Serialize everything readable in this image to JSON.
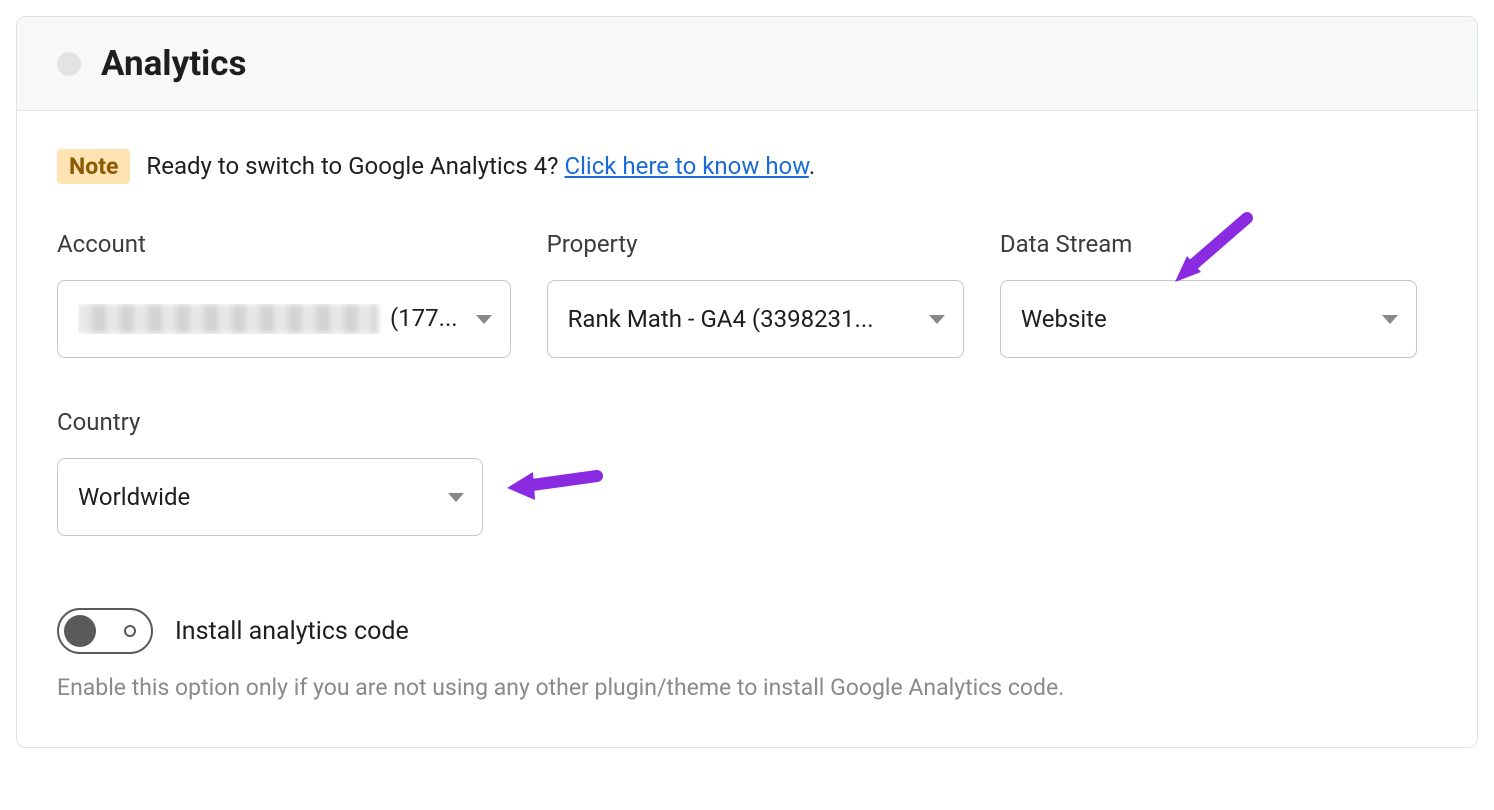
{
  "header": {
    "title": "Analytics"
  },
  "note": {
    "badge": "Note",
    "text": "Ready to switch to Google Analytics 4? ",
    "link_text": "Click here to know how",
    "suffix": "."
  },
  "fields": {
    "account": {
      "label": "Account",
      "value_suffix": " (177..."
    },
    "property": {
      "label": "Property",
      "value": "Rank Math - GA4 (3398231..."
    },
    "data_stream": {
      "label": "Data Stream",
      "value": "Website"
    },
    "country": {
      "label": "Country",
      "value": "Worldwide"
    }
  },
  "toggle": {
    "label": "Install analytics code",
    "description": "Enable this option only if you are not using any other plugin/theme to install Google Analytics code."
  }
}
